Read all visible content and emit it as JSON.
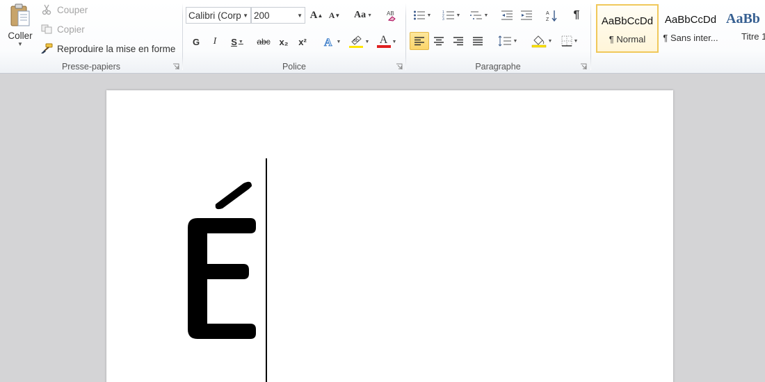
{
  "clipboard": {
    "paste_label": "Coller",
    "cut_label": "Couper",
    "copy_label": "Copier",
    "format_painter_label": "Reproduire la mise en forme",
    "group_label": "Presse-papiers"
  },
  "font": {
    "family_value": "Calibri (Corp",
    "size_value": "200",
    "bold_label": "G",
    "italic_label": "I",
    "underline_label": "S",
    "strike_label": "abc",
    "subscript_label": "x₂",
    "superscript_label": "x²",
    "change_case_label": "Aa",
    "grow_label": "A",
    "shrink_label": "A",
    "font_color_label": "A",
    "group_label": "Police"
  },
  "paragraph": {
    "group_label": "Paragraphe",
    "show_marks_label": "¶"
  },
  "styles": {
    "items": [
      {
        "sample": "AaBbCcDd",
        "name": "¶ Normal"
      },
      {
        "sample": "AaBbCcDd",
        "name": "¶ Sans inter..."
      },
      {
        "sample": "AaBb",
        "name": "Titre 1"
      }
    ]
  },
  "document": {
    "content": "É"
  },
  "colors": {
    "font_color_bar": "#e02020",
    "highlight_bar": "#ffe600",
    "active_align": "#fbd56a",
    "style_heading": "#365f91"
  }
}
